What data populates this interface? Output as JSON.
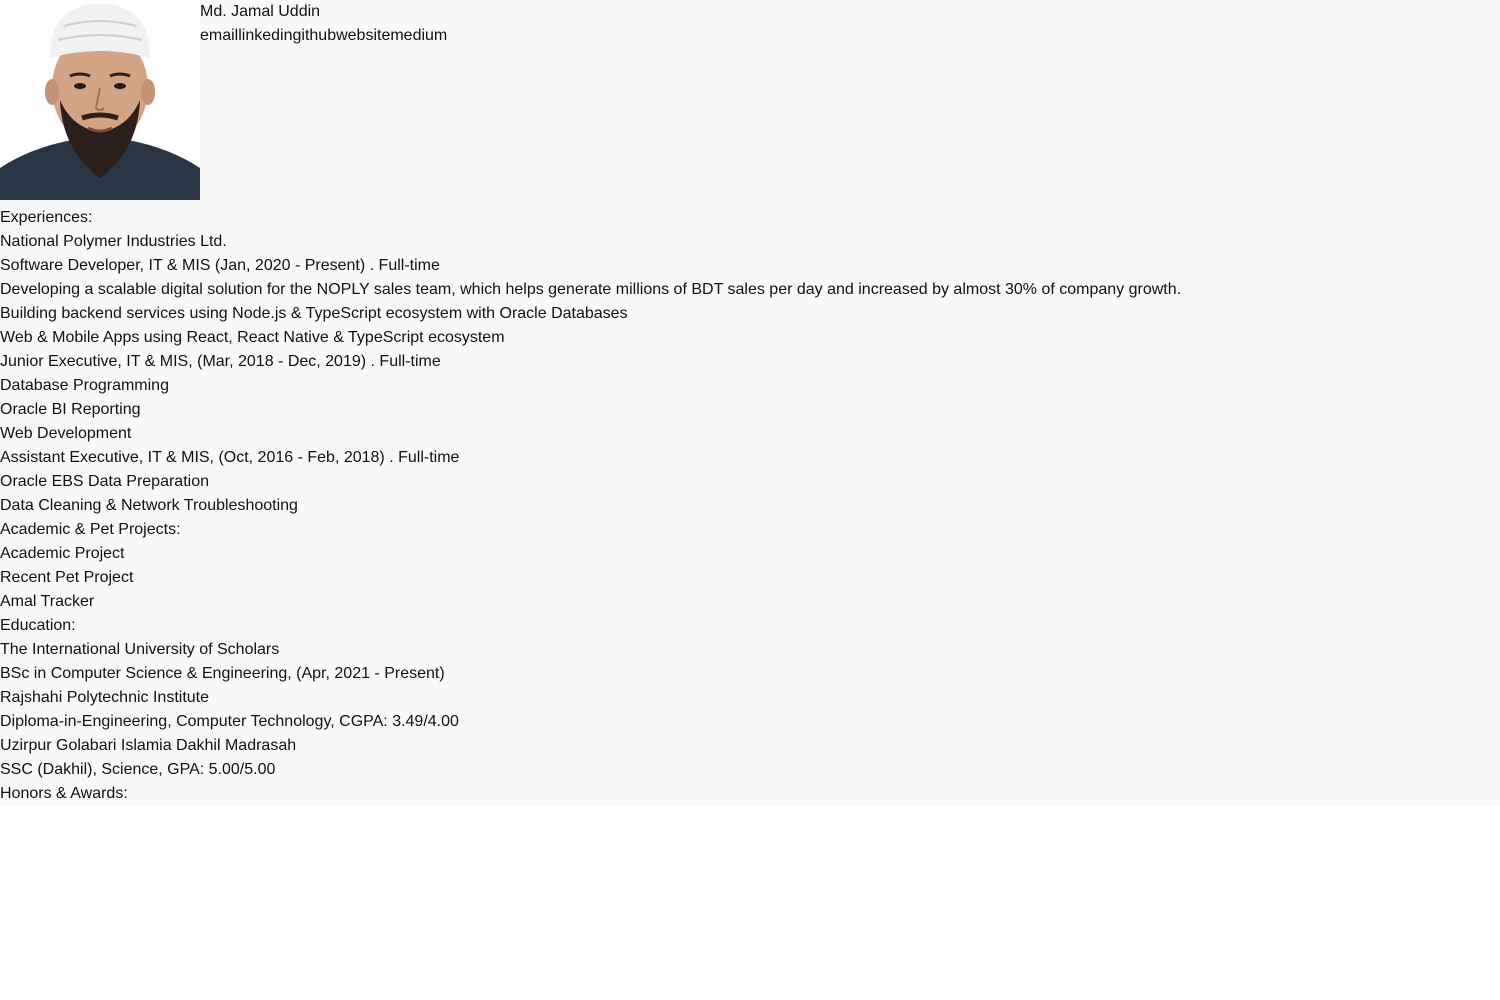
{
  "profile": {
    "name": "Md. Jamal Uddin",
    "links": [
      "email",
      "linkedin",
      "github",
      "website",
      "medium"
    ]
  },
  "experiences": {
    "heading": "Experiences:",
    "company": "National Polymer Industries Ltd.",
    "roles": [
      {
        "title": "Software Developer, IT & MIS (Jan, 2020 - Present) . Full-time",
        "items": [
          "Developing a scalable digital solution for the NOPLY sales team, which helps generate millions of BDT sales per day and increased by almost 30% of company growth.",
          "Building backend services using Node.js & TypeScript ecosystem with Oracle Databases",
          "Web & Mobile Apps using React, React Native & TypeScript ecosystem"
        ]
      },
      {
        "title": "Junior Executive, IT & MIS, (Mar, 2018 - Dec, 2019) . Full-time",
        "items": [
          "Database Programming",
          "Oracle BI Reporting",
          "Web Development"
        ]
      },
      {
        "title": "Assistant Executive, IT & MIS, (Oct, 2016 - Feb, 2018) . Full-time",
        "items": [
          "Oracle EBS Data Preparation",
          "Data Cleaning & Network Troubleshooting"
        ]
      }
    ]
  },
  "projects": {
    "heading": "Academic & Pet Projects:",
    "items": [
      "Academic Project",
      "Recent Pet Project",
      "Amal Tracker"
    ]
  },
  "education": {
    "heading": "Education:",
    "schools": [
      {
        "name": "The International University of Scholars",
        "detail": "BSc in Computer Science & Engineering, (Apr, 2021 - Present)"
      },
      {
        "name": "Rajshahi Polytechnic Institute",
        "detail": "Diploma-in-Engineering, Computer Technology, CGPA: 3.49/4.00"
      },
      {
        "name": "Uzirpur Golabari Islamia Dakhil Madrasah",
        "detail": "SSC (Dakhil), Science, GPA: 5.00/5.00"
      }
    ]
  },
  "awards": {
    "heading": "Honors & Awards:"
  },
  "colors": {
    "page_bg": "#f8f9fb",
    "text": "#111111"
  }
}
